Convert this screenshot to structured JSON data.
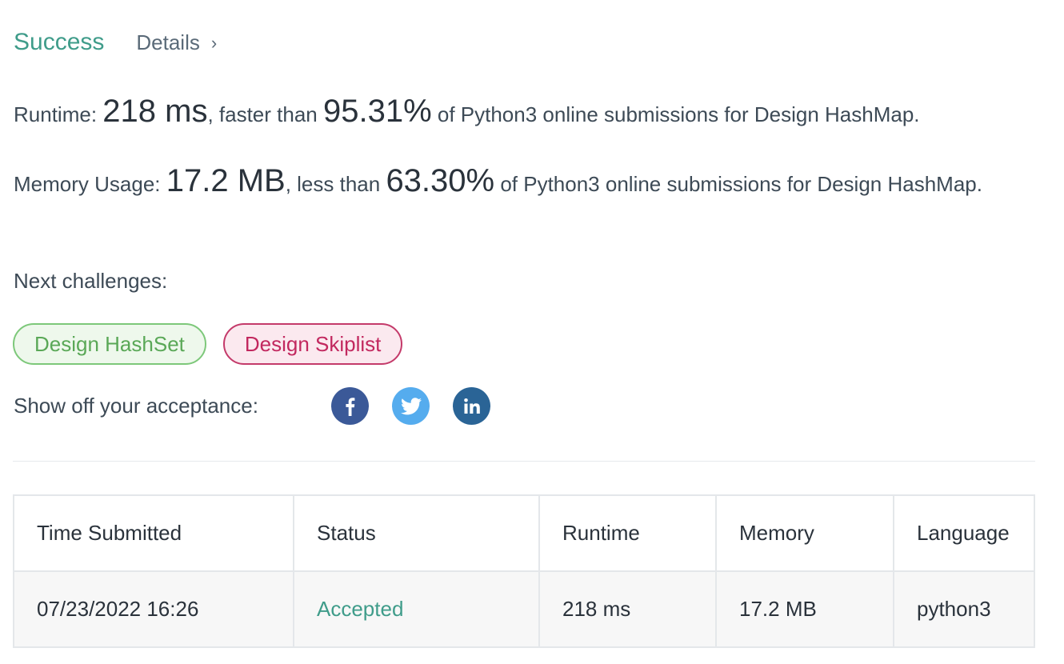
{
  "header": {
    "status": "Success",
    "details_label": "Details",
    "details_chevron": "›"
  },
  "runtime": {
    "prefix": "Runtime: ",
    "value": "218 ms",
    "middle": ", faster than ",
    "percent": "95.31%",
    "suffix": " of Python3 online submissions for Design HashMap."
  },
  "memory": {
    "prefix": "Memory Usage: ",
    "value": "17.2 MB",
    "middle": ", less than ",
    "percent": "63.30%",
    "suffix": " of Python3 online submissions for Design HashMap."
  },
  "next": {
    "label": "Next challenges:",
    "challenges": [
      {
        "label": "Design HashSet",
        "difficulty": "easy",
        "color": "#5aa857"
      },
      {
        "label": "Design Skiplist",
        "difficulty": "hard",
        "color": "#c2285f"
      }
    ]
  },
  "share": {
    "label": "Show off your acceptance:",
    "networks": [
      {
        "icon": "facebook-icon",
        "color": "#3b5998"
      },
      {
        "icon": "twitter-icon",
        "color": "#55acee"
      },
      {
        "icon": "linkedin-icon",
        "color": "#2a6496"
      }
    ]
  },
  "table": {
    "headers": [
      "Time Submitted",
      "Status",
      "Runtime",
      "Memory",
      "Language"
    ],
    "rows": [
      {
        "time": "07/23/2022 16:26",
        "status": "Accepted",
        "runtime": "218 ms",
        "memory": "17.2 MB",
        "language": "python3"
      }
    ]
  },
  "colors": {
    "success": "#3f9c8a",
    "text": "#3d4a56"
  }
}
